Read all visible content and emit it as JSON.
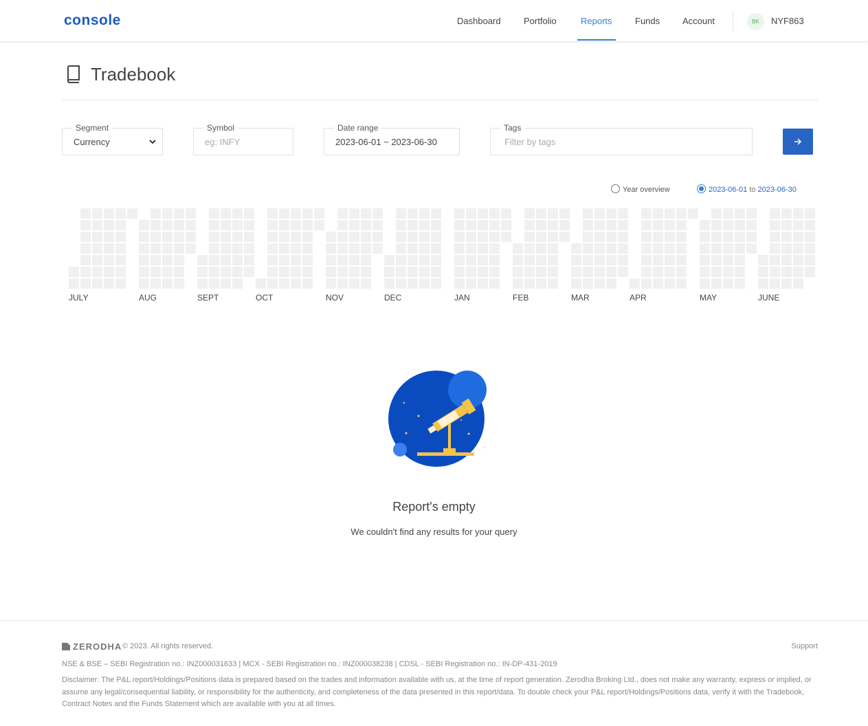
{
  "header": {
    "logo": "console",
    "nav": [
      {
        "label": "Dashboard",
        "active": false
      },
      {
        "label": "Portfolio",
        "active": false
      },
      {
        "label": "Reports",
        "active": true
      },
      {
        "label": "Funds",
        "active": false
      },
      {
        "label": "Account",
        "active": false
      }
    ],
    "user": {
      "initials": "BK",
      "id": "NYF863"
    }
  },
  "page": {
    "title": "Tradebook",
    "icon": "book-icon"
  },
  "filters": {
    "segment": {
      "label": "Segment",
      "value": "Currency"
    },
    "symbol": {
      "label": "Symbol",
      "placeholder": "eg: INFY"
    },
    "date_range": {
      "label": "Date range",
      "value": "2023-06-01 ~ 2023-06-30"
    },
    "tags": {
      "label": "Tags",
      "placeholder": "Filter by tags"
    },
    "submit_icon": "arrow-right-icon"
  },
  "view_toggle": {
    "year_overview": {
      "label": "Year overview",
      "selected": false
    },
    "range": {
      "from": "2023-06-01",
      "to_word": "to",
      "to": "2023-06-30",
      "selected": true
    }
  },
  "heatmap": {
    "months": [
      "JULY",
      "AUG",
      "SEPT",
      "OCT",
      "NOV",
      "DEC",
      "JAN",
      "FEB",
      "MAR",
      "APR",
      "MAY",
      "JUNE"
    ],
    "cell_color": "#f0f0f0"
  },
  "empty_state": {
    "title": "Report's empty",
    "message": "We couldn't find any results for your query",
    "illustration": "telescope-illustration"
  },
  "footer": {
    "brand": "ZERODHA",
    "copyright": "© 2023. All rights reserved.",
    "support": "Support",
    "registration": "NSE & BSE – SEBI Registration no.: INZ000031633 | MCX - SEBI Registration no.: INZ000038238 | CDSL - SEBI Registration no.: IN-DP-431-2019",
    "disclaimer": "Disclaimer: The P&L report/Holdings/Positions data is prepared based on the trades and information available with us, at the time of report generation. Zerodha Broking Ltd., does not make any warranty, express or implied, or assume any legal/consequential liability, or responsibility for the authenticity, and completeness of the data presented in this report/data. To double check your P&L report/Holdings/Positions data, verify it with the Tradebook, Contract Notes and the Funds Statement which are available with you at all times."
  },
  "colors": {
    "accent": "#387ed1",
    "button": "#2865c4",
    "logo": "#1c5bbf"
  }
}
